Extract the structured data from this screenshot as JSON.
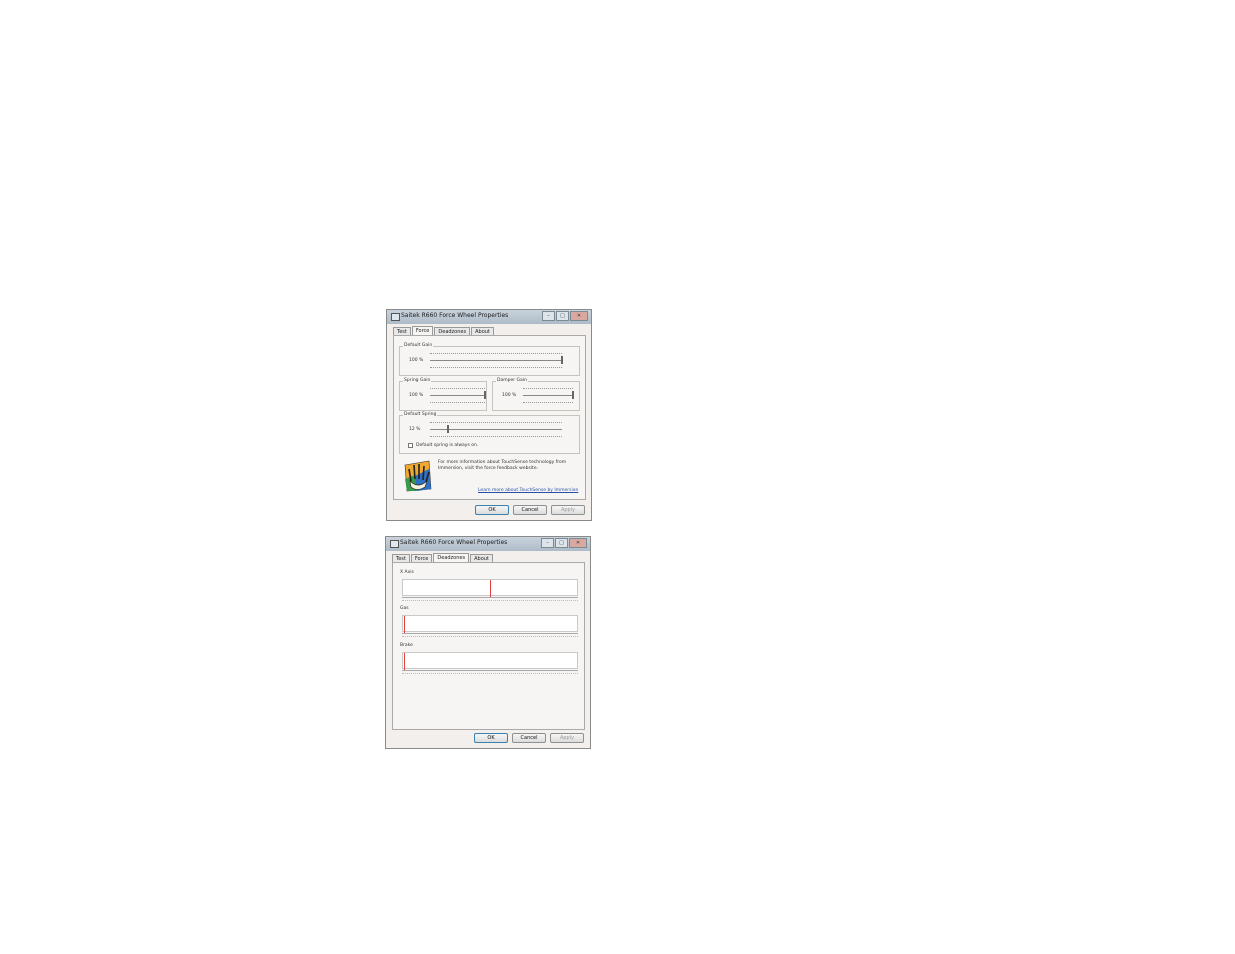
{
  "window1": {
    "title": "Saitek R660 Force Wheel Properties",
    "tabs": [
      "Test",
      "Force",
      "Deadzones",
      "About"
    ],
    "active_tab": "Force",
    "default_gain": {
      "label": "Default Gain",
      "value_text": "100 %",
      "value": 100
    },
    "spring_gain": {
      "label": "Spring Gain",
      "value_text": "100 %",
      "value": 100
    },
    "damper_gain": {
      "label": "Damper Gain",
      "value_text": "100 %",
      "value": 100
    },
    "default_spring": {
      "label": "Default Spring",
      "value_text": "12 %",
      "value": 12
    },
    "always_on_label": "Default spring is always on.",
    "info_text": "For more information about TouchSense technology from Immersion, visit the force feedback website.",
    "link_text": "Learn more about TouchSense by Immersion",
    "buttons": {
      "ok": "OK",
      "cancel": "Cancel",
      "apply": "Apply"
    }
  },
  "window2": {
    "title": "Saitek R660 Force Wheel Properties",
    "tabs": [
      "Test",
      "Force",
      "Deadzones",
      "About"
    ],
    "active_tab": "Deadzones",
    "axes": [
      {
        "label": "X Axis",
        "indicator_position": 0.5
      },
      {
        "label": "Gas",
        "indicator_position": 0.0
      },
      {
        "label": "Brake",
        "indicator_position": 0.0
      }
    ],
    "buttons": {
      "ok": "OK",
      "cancel": "Cancel",
      "apply": "Apply"
    }
  },
  "colors": {
    "indicator": "#e04040",
    "link": "#2a4fa8",
    "default_button_border": "#3c7fb1"
  }
}
